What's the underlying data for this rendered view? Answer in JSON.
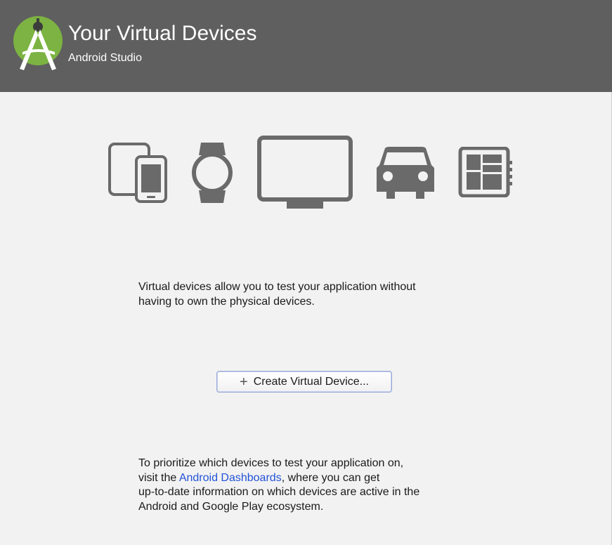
{
  "header": {
    "title": "Your Virtual Devices",
    "subtitle": "Android Studio",
    "background": "#5f5f5f",
    "logo_icon": "android-studio-logo"
  },
  "device_icons": [
    "phone-tablet-icon",
    "watch-icon",
    "tv-icon",
    "car-icon",
    "things-board-icon"
  ],
  "description": {
    "line1": "Virtual devices allow you to test your application without",
    "line2": "having to own the physical devices."
  },
  "create_button": {
    "icon": "plus-icon",
    "label": "Create Virtual Device..."
  },
  "info": {
    "part1": "To prioritize which devices to test your application on,",
    "part2_prefix": "visit the ",
    "link_text": "Android Dashboards",
    "part2_suffix": ", where you can get",
    "part3": "up-to-date information on which devices are active in the",
    "part4": "Android and Google Play ecosystem."
  },
  "colors": {
    "icon_gray": "#6a6a6a",
    "link": "#2253d8",
    "logo_green": "#7cb342",
    "body_bg": "#f2f2f2"
  }
}
